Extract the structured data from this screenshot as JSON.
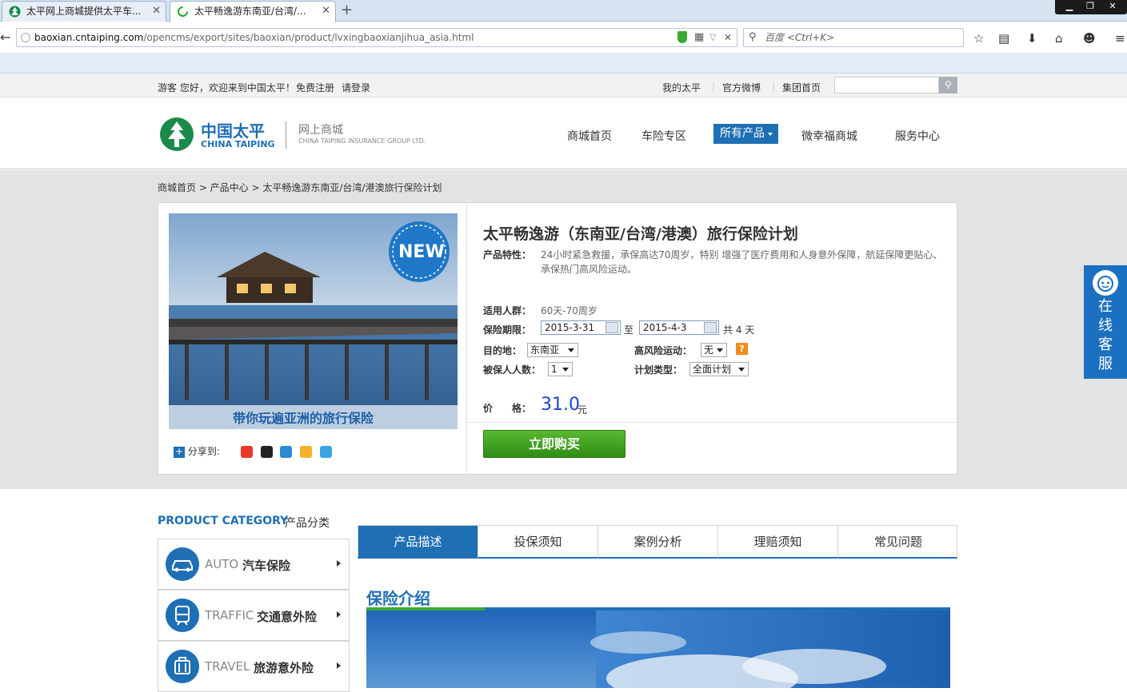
{
  "browser": {
    "tabs": [
      {
        "label": "太平网上商城提供太平车..."
      },
      {
        "label": "太平畅逸游东南亚/台湾/..."
      }
    ],
    "url_host": "baoxian.cntaiping.com",
    "url_path": "/opencms/export/sites/baoxian/product/lvxingbaoxianjihua_asia.html",
    "search_placeholder": "百度 <Ctrl+K>"
  },
  "topbar": {
    "welcome": "游客 您好，欢迎来到中国太平！",
    "register": "免费注册",
    "login": "请登录",
    "links": [
      "我的太平",
      "官方微博",
      "集团首页"
    ]
  },
  "logo": {
    "cn": "中国太平",
    "en": "CHINA TAIPING",
    "sub_cn": "网上商城",
    "sub_en": "CHINA TAIPING INSURANCE GROUP LTD."
  },
  "nav": {
    "items": [
      "商城首页",
      "车险专区",
      "所有产品",
      "微幸福商城",
      "服务中心"
    ]
  },
  "breadcrumb": "商城首页 > 产品中心 > 太平畅逸游东南亚/台湾/港澳旅行保险计划",
  "product": {
    "banner_badge": "NEW",
    "banner_caption": "带你玩遍亚洲的旅行保险",
    "share_label": "分享到:",
    "title": "太平畅逸游（东南亚/台湾/港澳）旅行保险计划",
    "feature_label": "产品特性：",
    "feature_line1": "24小时紧急救援，承保高达70周岁，特别 增强了医疗费用和人身意外保障，航延保障更贴心、",
    "feature_line2": "承保热门高风险运动。",
    "age_label": "适用人群：",
    "age_value": "60天-70周岁",
    "period_label": "保险期限：",
    "start_date": "2015-3-31",
    "to_label": "至",
    "end_date": "2015-4-3",
    "days_text": "共 4 天",
    "dest_label": "目的地：",
    "dest_value": "东南亚",
    "risk_label": "高风险运动：",
    "risk_value": "无",
    "help_mark": "?",
    "insured_label": "被保人人数：",
    "insured_value": "1",
    "plan_label": "计划类型：",
    "plan_value": "全面计划",
    "price_label": "价　　格：",
    "price_value": "31.0",
    "price_unit": "元",
    "buy_label": "立即购买"
  },
  "kefu": "在线客服",
  "category": {
    "title_en": "PRODUCT CATEGORY",
    "title_cn": "产品分类",
    "items": [
      {
        "en": "AUTO",
        "cn": "汽车保险",
        "icon": "car-icon"
      },
      {
        "en": "TRAFFIC",
        "cn": "交通意外险",
        "icon": "train-icon"
      },
      {
        "en": "TRAVEL",
        "cn": "旅游意外险",
        "icon": "luggage-icon"
      }
    ]
  },
  "detail_tabs": [
    "产品描述",
    "投保须知",
    "案例分析",
    "理赔须知",
    "常见问题"
  ],
  "section_title": "保险介绍",
  "colors": {
    "brand_blue": "#1f6fb5",
    "buy_green": "#3c9e1f",
    "price_blue": "#1a45c9"
  }
}
